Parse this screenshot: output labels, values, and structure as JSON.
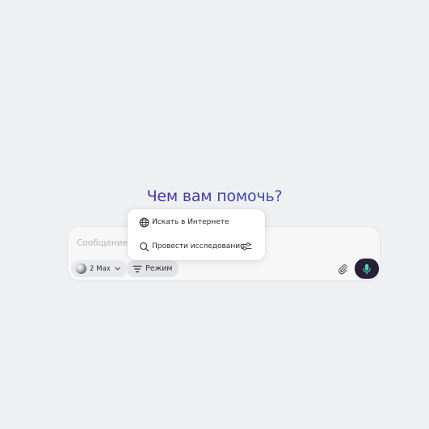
{
  "greeting": "Чем вам помочь?",
  "composer": {
    "placeholder": "Сообщение",
    "model": {
      "label": "2 Max",
      "icon": "model-logo-icon"
    },
    "mode_button": {
      "label": "Режим",
      "icon": "filter-icon"
    },
    "attach_icon": "paperclip-icon",
    "mic_icon": "microphone-icon"
  },
  "mode_menu": {
    "items": [
      {
        "label": "Искать в Интернете",
        "icon": "globe-icon"
      },
      {
        "label": "Провести исследование",
        "icon": "search-icon",
        "trailing_icon": "sliders-icon"
      }
    ]
  },
  "colors": {
    "background": "#eff0f2",
    "greeting_gradient_start": "#4a2596",
    "greeting_gradient_end": "#2f7ea8",
    "mic_button": "#2b1f35",
    "mic_glyph": "#3fd9b0"
  }
}
